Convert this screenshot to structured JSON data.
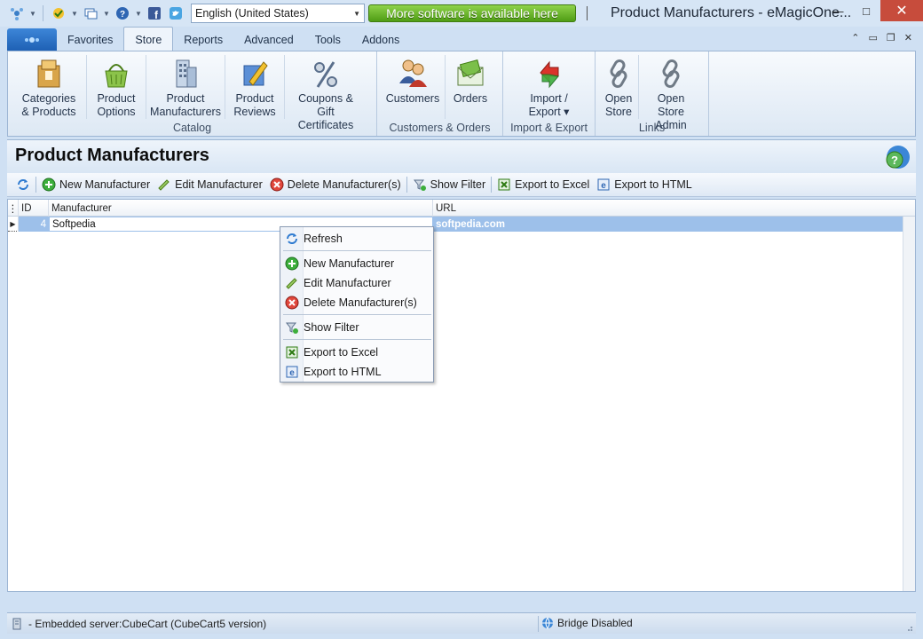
{
  "titlebar": {
    "language": "English (United States)",
    "promo": "More software is available here",
    "window_title": "Product Manufacturers - eMagicOne...",
    "min": "—",
    "max": "□",
    "close": "✕"
  },
  "tabs": [
    "Favorites",
    "Store",
    "Reports",
    "Advanced",
    "Tools",
    "Addons"
  ],
  "active_tab": "Store",
  "ribbon": {
    "catalog": {
      "label": "Catalog",
      "buttons": [
        "Categories\n& Products",
        "Product\nOptions",
        "Product\nManufacturers",
        "Product\nReviews",
        "Coupons &\nGift Certificates"
      ]
    },
    "customers_orders": {
      "label": "Customers & Orders",
      "buttons": [
        "Customers",
        "Orders"
      ]
    },
    "import_export": {
      "label": "Import & Export",
      "buttons": [
        "Import /\nExport ▾"
      ]
    },
    "links": {
      "label": "Links",
      "buttons": [
        "Open\nStore",
        "Open Store\nAdmin"
      ]
    }
  },
  "page": {
    "title": "Product Manufacturers"
  },
  "toolbar": {
    "new": "New Manufacturer",
    "edit": "Edit Manufacturer",
    "delete": "Delete Manufacturer(s)",
    "filter": "Show Filter",
    "excel": "Export to Excel",
    "html": "Export to HTML"
  },
  "grid": {
    "columns": [
      "ID",
      "Manufacturer",
      "URL"
    ],
    "rows": [
      {
        "id": "4",
        "manufacturer": "Softpedia",
        "url": "softpedia.com"
      }
    ]
  },
  "context_menu": {
    "refresh": "Refresh",
    "new": "New Manufacturer",
    "edit": "Edit Manufacturer",
    "delete": "Delete Manufacturer(s)",
    "filter": "Show Filter",
    "excel": "Export to Excel",
    "html": "Export to HTML"
  },
  "statusbar": {
    "server": "- Embedded server:CubeCart (CubeCart5 version)",
    "bridge": "Bridge Disabled"
  },
  "colors": {
    "accent": "#1d5fb3",
    "promo_green": "#4f9d14",
    "selection": "#9dc0ea",
    "close_red": "#c74c3c"
  }
}
